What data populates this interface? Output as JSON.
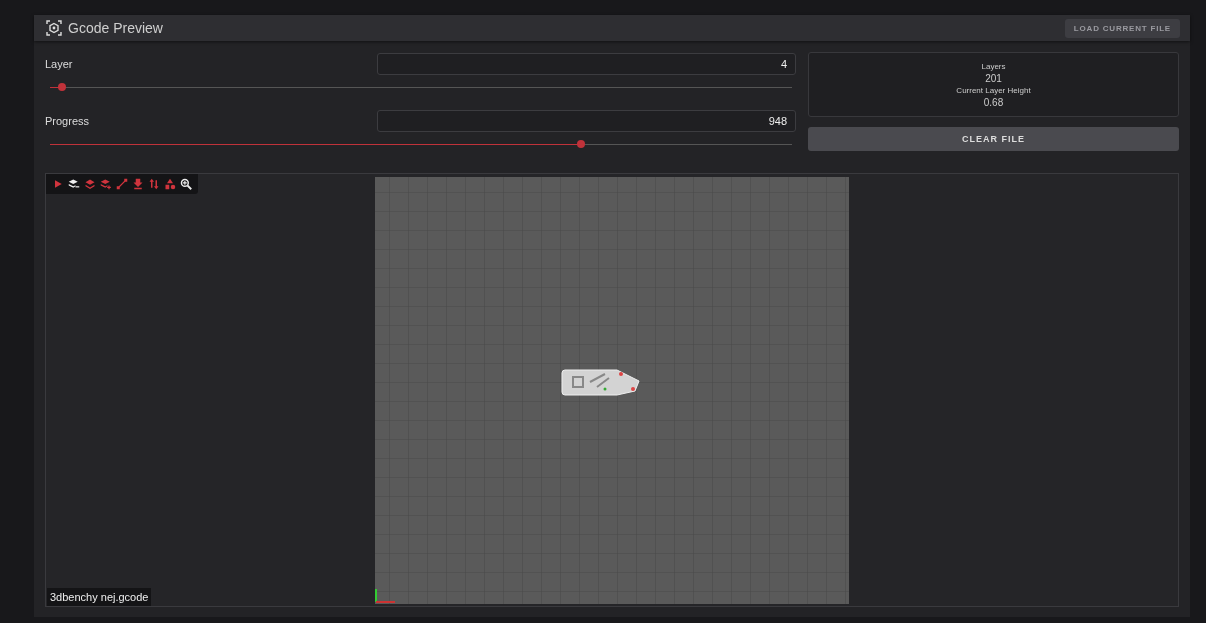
{
  "panel": {
    "title": "Gcode Preview",
    "load_button": "LOAD CURRENT FILE"
  },
  "controls": [
    {
      "label": "Layer",
      "value": "4",
      "level": 0.016
    },
    {
      "label": "Progress",
      "value": "948",
      "level": 0.716
    }
  ],
  "info": [
    {
      "label": "Layers",
      "value": "201"
    },
    {
      "label": "Current Layer Height",
      "value": "0.68"
    }
  ],
  "clear_button": "CLEAR FILE",
  "viewer": {
    "file_name": "3dbenchy nej.gcode"
  }
}
